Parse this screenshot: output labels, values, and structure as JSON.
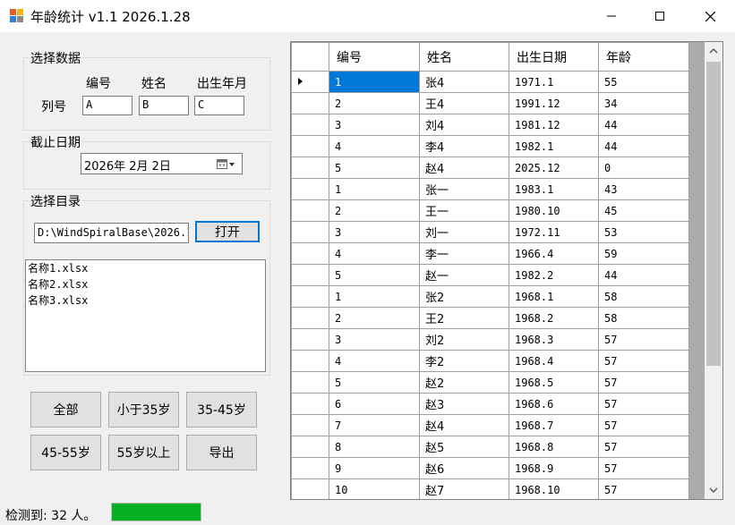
{
  "window": {
    "title": "年龄统计 v1.1 2026.1.28"
  },
  "select_data": {
    "title": "选择数据",
    "col_headers": [
      "编号",
      "姓名",
      "出生年月"
    ],
    "row_label": "列号",
    "values": [
      "A",
      "B",
      "C"
    ]
  },
  "cutoff": {
    "title": "截止日期",
    "date": "2026年  2月  2日"
  },
  "directory": {
    "title": "选择目录",
    "path": "D:\\WindSpiralBase\\2026.1",
    "open_label": "打开",
    "files": [
      "名称1.xlsx",
      "名称2.xlsx",
      "名称3.xlsx"
    ]
  },
  "filters": {
    "all": "全部",
    "under35": "小于35岁",
    "r35_45": "35-45岁",
    "r45_55": "45-55岁",
    "over55": "55岁以上",
    "export": "导出"
  },
  "grid": {
    "columns": [
      "编号",
      "姓名",
      "出生日期",
      "年龄"
    ],
    "rows": [
      [
        "1",
        "张4",
        "1971.1",
        "55"
      ],
      [
        "2",
        "王4",
        "1991.12",
        "34"
      ],
      [
        "3",
        "刘4",
        "1981.12",
        "44"
      ],
      [
        "4",
        "李4",
        "1982.1",
        "44"
      ],
      [
        "5",
        "赵4",
        "2025.12",
        "0"
      ],
      [
        "1",
        "张一",
        "1983.1",
        "43"
      ],
      [
        "2",
        "王一",
        "1980.10",
        "45"
      ],
      [
        "3",
        "刘一",
        "1972.11",
        "53"
      ],
      [
        "4",
        "李一",
        "1966.4",
        "59"
      ],
      [
        "5",
        "赵一",
        "1982.2",
        "44"
      ],
      [
        "1",
        "张2",
        "1968.1",
        "58"
      ],
      [
        "2",
        "王2",
        "1968.2",
        "58"
      ],
      [
        "3",
        "刘2",
        "1968.3",
        "57"
      ],
      [
        "4",
        "李2",
        "1968.4",
        "57"
      ],
      [
        "5",
        "赵2",
        "1968.5",
        "57"
      ],
      [
        "6",
        "赵3",
        "1968.6",
        "57"
      ],
      [
        "7",
        "赵4",
        "1968.7",
        "57"
      ],
      [
        "8",
        "赵5",
        "1968.8",
        "57"
      ],
      [
        "9",
        "赵6",
        "1968.9",
        "57"
      ],
      [
        "10",
        "赵7",
        "1968.10",
        "57"
      ]
    ],
    "selected_row": 0
  },
  "status": {
    "text": "检测到: 32 人。",
    "progress": 1.0,
    "progress_color": "#06b025"
  },
  "icons": {
    "app": "app-window-icon",
    "calendar": "calendar-dropdown-icon"
  }
}
